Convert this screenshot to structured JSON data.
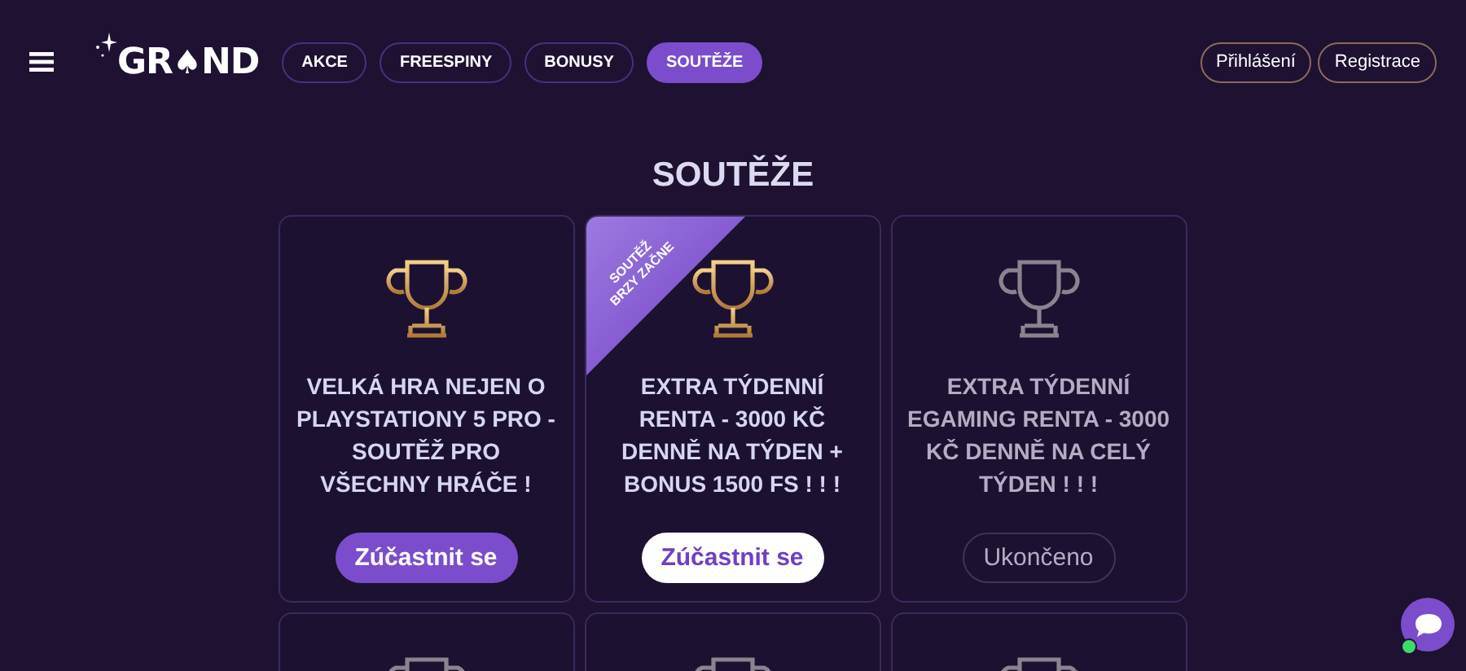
{
  "header": {
    "logo": "GR♠ND",
    "nav": [
      {
        "label": "AKCE",
        "selected": false
      },
      {
        "label": "FREESPINY",
        "selected": false
      },
      {
        "label": "BONUSY",
        "selected": false
      },
      {
        "label": "SOUTĚŽE",
        "selected": true
      }
    ],
    "account": [
      "Přihlášení",
      "Registrace"
    ]
  },
  "page_title": "SOUTĚŽE",
  "cards": [
    {
      "kind": "active",
      "title": "VELKÁ HRA NEJEN O PLAYSTATIONY 5 PRO - SOUTĚŽ PRO VŠECHNY HRÁČE !",
      "button": "Zúčastnit se"
    },
    {
      "kind": "upcoming",
      "ribbon": "SOUTĚŽ BRZY ZAČNE",
      "title": "EXTRA TÝDENNÍ RENTA - 3000 KČ DENNĚ NA TÝDEN + BONUS 1500 FS ! ! !",
      "button": "Zúčastnit se"
    },
    {
      "kind": "ended",
      "title": "EXTRA TÝDENNÍ EGAMING RENTA - 3000 KČ DENNĚ NA CELÝ TÝDEN ! ! !",
      "button": "Ukončeno"
    },
    {
      "kind": "ended"
    },
    {
      "kind": "ended"
    },
    {
      "kind": "ended"
    }
  ],
  "chat": {
    "online": true
  }
}
